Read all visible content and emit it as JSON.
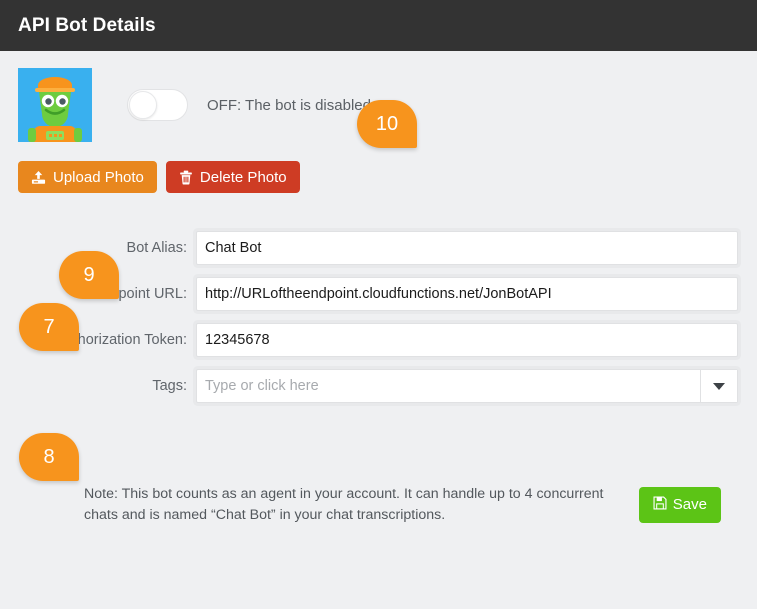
{
  "header": {
    "title": "API Bot Details"
  },
  "avatar": {
    "icon": "robot-avatar-icon",
    "background_color": "#39b0ef"
  },
  "toggle": {
    "state": "off",
    "label": "OFF: The bot is disabled"
  },
  "photo_buttons": {
    "upload": {
      "label": "Upload Photo",
      "icon": "upload-icon",
      "color": "#e8871e"
    },
    "delete": {
      "label": "Delete Photo",
      "icon": "trash-icon",
      "color": "#ce3c24"
    }
  },
  "form": {
    "fields": [
      {
        "label": "Bot Alias:",
        "value": "Chat Bot",
        "placeholder": ""
      },
      {
        "label": "Endpoint URL:",
        "value": "http://URLoftheendpoint.cloudfunctions.net/JonBotAPI",
        "placeholder": ""
      },
      {
        "label": "Authorization Token:",
        "value": "12345678",
        "placeholder": ""
      },
      {
        "label": "Tags:",
        "value": "",
        "placeholder": "Type or click here"
      }
    ]
  },
  "footer": {
    "note": "Note: This bot counts as an agent in your account. It can handle up to 4 concurrent chats and is named “Chat Bot” in your chat transcriptions.",
    "save": {
      "label": "Save",
      "icon": "floppy-disk-icon",
      "color": "#5cc416"
    }
  },
  "badges": [
    {
      "number": "10"
    },
    {
      "number": "9"
    },
    {
      "number": "7"
    },
    {
      "number": "8"
    }
  ],
  "colors": {
    "header_bg": "#333333",
    "page_bg": "#eff0f2",
    "badge": "#f7941d"
  }
}
